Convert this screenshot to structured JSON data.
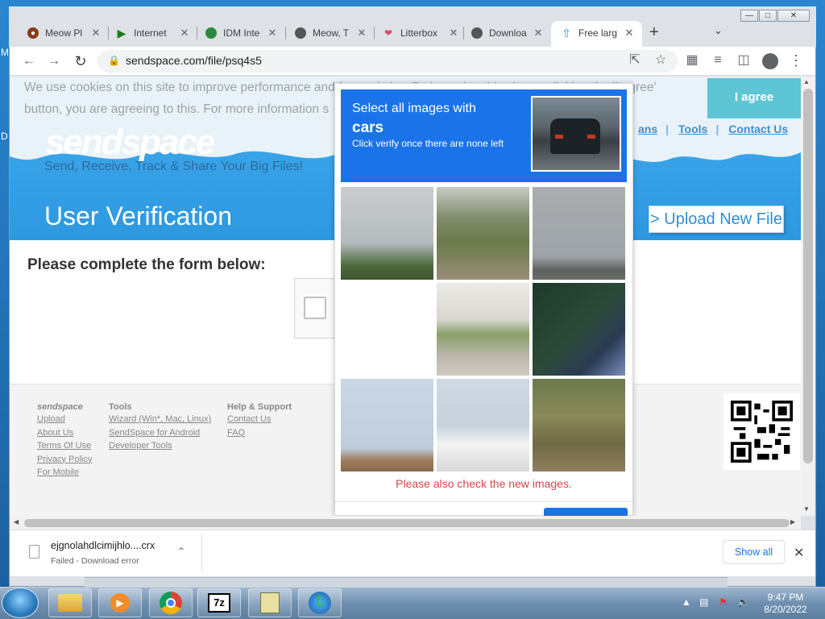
{
  "desktop": {
    "label1": "M",
    "label2": "D"
  },
  "browser": {
    "tabs": [
      {
        "title": "Meow Pl",
        "icon": "paw-icon",
        "color": "#8b3a1a"
      },
      {
        "title": "Internet",
        "icon": "play-icon",
        "color": "#1a7a1a"
      },
      {
        "title": "IDM Inte",
        "icon": "globe-icon",
        "color": "#2a8a3a"
      },
      {
        "title": "Meow, T",
        "icon": "globe-icon",
        "color": "#555"
      },
      {
        "title": "Litterbox",
        "icon": "heart-icon",
        "color": "#d0506a"
      },
      {
        "title": "Downloa",
        "icon": "globe-icon",
        "color": "#555"
      },
      {
        "title": "Free larg",
        "icon": "upload-arrow-icon",
        "color": "#2d8fd6",
        "active": true
      }
    ],
    "new_tab": "+",
    "url": "sendspace.com/file/psq4s5"
  },
  "cookie": {
    "line1": "We use cookies on this site to improve performance and for analytics. By browsing this site, or clicking the 'I agree'",
    "line2": "button, you are agreeing to this. For more information s",
    "agree_label": "I agree"
  },
  "site": {
    "logo": "sendspace",
    "tagline": "Send, Receive, Track & Share Your Big Files!",
    "nav": [
      "ans",
      "Tools",
      "Contact Us"
    ],
    "section_title": "User Verification",
    "upload_label": "> Upload New File",
    "form_title": "Please complete the form below:"
  },
  "footer": {
    "col1_head": "sendspace",
    "col1": [
      "Upload",
      "About Us",
      "Terms Of Use",
      "Privacy Policy",
      "For Mobile"
    ],
    "col2_head": "Tools",
    "col2": [
      "Wizard (Win*, Mac, Linux)",
      "SendSpace for Android",
      "Developer Tools"
    ],
    "col3_head": "Help & Support",
    "col3": [
      "Contact Us",
      "FAQ"
    ]
  },
  "captcha": {
    "instruction": "Select all images with",
    "target": "cars",
    "hint": "Click verify once there are none left",
    "message": "Please also check the new images."
  },
  "download": {
    "filename": "ejgnolahdlcimijhlo....crx",
    "status": "Failed - Download error",
    "show_all": "Show all"
  },
  "taskbar": {
    "time": "9:47 PM",
    "date": "8/20/2022",
    "sevenzip": "7z"
  }
}
